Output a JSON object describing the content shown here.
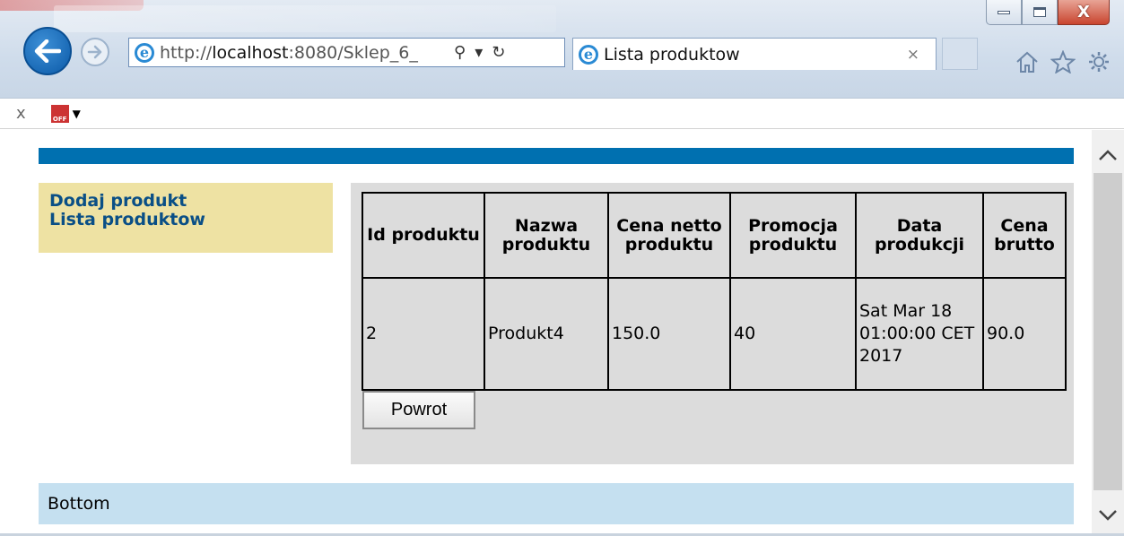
{
  "browser": {
    "address": {
      "url_prefix": "http://",
      "url_host": "localhost",
      "url_rest": ":8080/Sklep_6_",
      "search_glyph": "⚲",
      "dropdown_glyph": "▾",
      "refresh_glyph": "↻"
    },
    "tab": {
      "title": "Lista produktow",
      "close_glyph": "×"
    },
    "window_controls": {
      "close_glyph": "X"
    },
    "toolbar_icons": [
      "home-icon",
      "favorites-star-icon",
      "settings-gear-icon"
    ],
    "commandbar": {
      "close_glyph": "x",
      "badge_text": "OFF"
    }
  },
  "page": {
    "menu": {
      "items": [
        "Dodaj produkt",
        "Lista produktow"
      ]
    },
    "table": {
      "headers": [
        "Id produktu",
        "Nazwa produktu",
        "Cena netto produktu",
        "Promocja produktu",
        "Data produkcji",
        "Cena brutto"
      ],
      "rows": [
        [
          "2",
          "Produkt4",
          "150.0",
          "40",
          "Sat Mar 18 01:00:00 CET 2017",
          "90.0"
        ]
      ]
    },
    "back_button_label": "Powrot",
    "footer_text": "Bottom"
  },
  "colors": {
    "header_bar": "#0070b0",
    "menu_background": "#eee2a3",
    "menu_link": "#0a4f86",
    "main_background": "#dcdcdc",
    "footer_background": "#c5e0f0"
  }
}
